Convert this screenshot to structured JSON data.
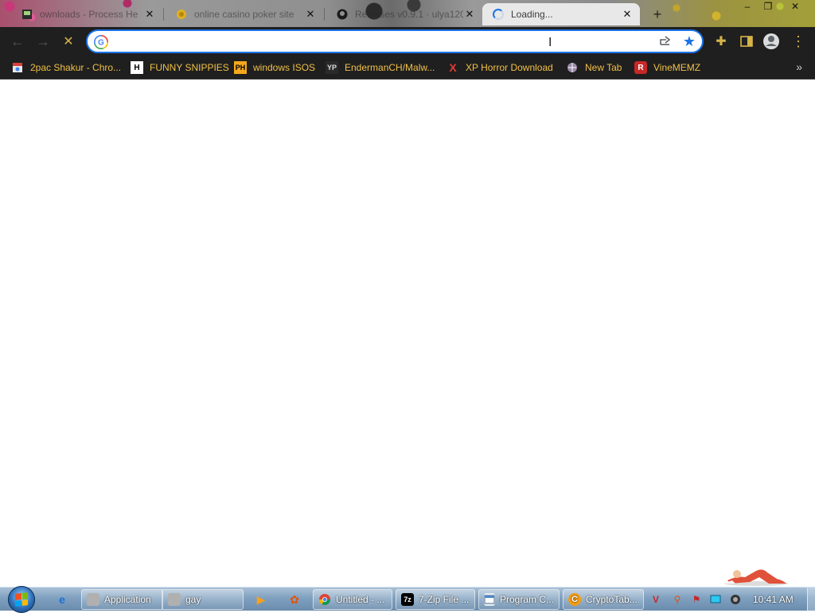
{
  "tabs": [
    {
      "title": "ownloads - Process He",
      "favicon": "process-hacker-icon"
    },
    {
      "title": "online casino poker site",
      "favicon": "casino-coin-icon"
    },
    {
      "title": "Releases v0.9.1 · ulya120",
      "favicon": "github-icon"
    },
    {
      "title": "Loading...",
      "favicon": "loading-spinner-icon",
      "active": true
    }
  ],
  "window_controls": {
    "minimize": "–",
    "maximize": "❐",
    "close": "✕"
  },
  "toolbar": {
    "back": "←",
    "forward": "→",
    "stop": "✕",
    "omnibox_value": "",
    "extensions": "✚",
    "side_panel": "▮",
    "menu": "⋮"
  },
  "bookmarks": [
    {
      "label": "2pac Shakur - Chro...",
      "favicon": "chrome-web-store-icon"
    },
    {
      "label": "FUNNY SNIPPIES",
      "favicon": "H"
    },
    {
      "label": "windows ISOS",
      "favicon": "PH"
    },
    {
      "label": "EndermanCH/Malw...",
      "favicon": "YP"
    },
    {
      "label": "XP Horror Download",
      "favicon": "X"
    },
    {
      "label": "New Tab",
      "favicon": "globe-icon"
    },
    {
      "label": "VineMEMZ",
      "favicon": "R"
    }
  ],
  "bookmarks_overflow": "»",
  "taskbar": {
    "items": [
      {
        "label": "Application",
        "icon": "app-icon"
      },
      {
        "label": "gay",
        "icon": "app-icon"
      },
      {
        "label": "Untitled - ...",
        "icon": "chrome-icon"
      },
      {
        "label": "7-Zip File ...",
        "icon": "7z"
      },
      {
        "label": "Program C...",
        "icon": "control-panel-icon"
      },
      {
        "label": "CryptoTab...",
        "icon": "cryptotab-icon"
      }
    ],
    "clock": "10:41 AM"
  },
  "colors": {
    "accent": "#1a73e8",
    "bookmark_text": "#f0c048",
    "toolbar_bg": "#1f1f1f"
  }
}
